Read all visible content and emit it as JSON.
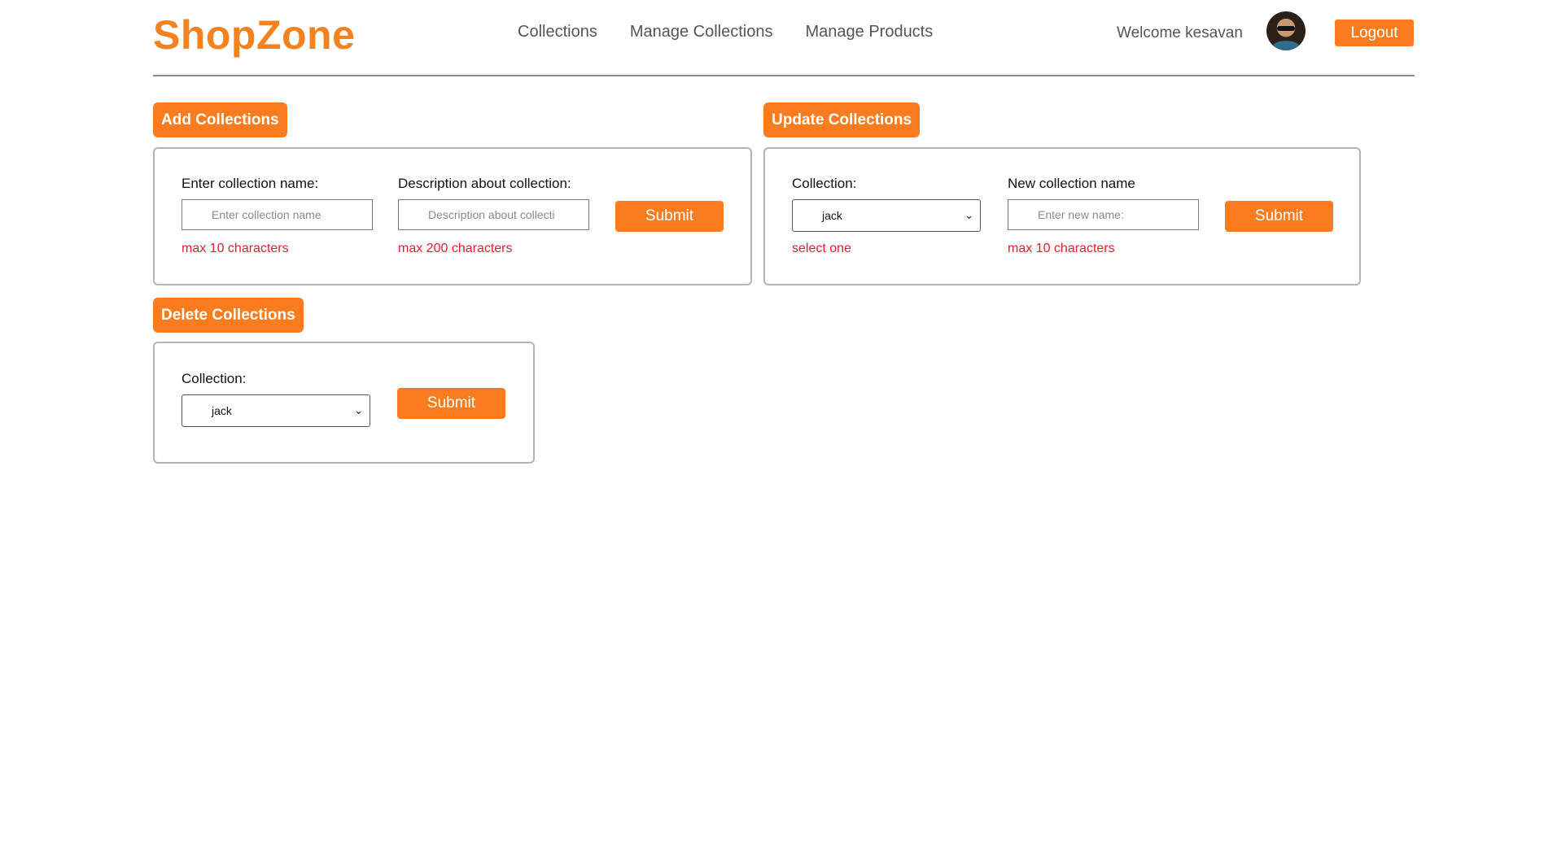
{
  "header": {
    "brand": "ShopZone",
    "nav": [
      "Collections",
      "Manage Collections",
      "Manage Products"
    ],
    "welcome": "Welcome kesavan",
    "logout": "Logout"
  },
  "add": {
    "title": "Add Collections",
    "name_label": "Enter collection name:",
    "name_placeholder": "Enter collection name",
    "name_hint": "max 10 characters",
    "desc_label": "Description about collection:",
    "desc_placeholder": "Description about collecti",
    "desc_hint": "max 200 characters",
    "submit": "Submit"
  },
  "update": {
    "title": "Update Collections",
    "collection_label": "Collection:",
    "collection_value": "jack",
    "collection_hint": "select one",
    "new_label": "New collection name",
    "new_placeholder": "Enter new name:",
    "new_hint": "max 10 characters",
    "submit": "Submit"
  },
  "delete": {
    "title": "Delete Collections",
    "collection_label": "Collection:",
    "collection_value": "jack",
    "submit": "Submit"
  },
  "colors": {
    "accent": "#fb7c1e",
    "brand": "#f5821f",
    "error": "#e0202c"
  },
  "icons": {
    "select_arrow": "chevron-down-icon",
    "avatar": "user-avatar"
  }
}
